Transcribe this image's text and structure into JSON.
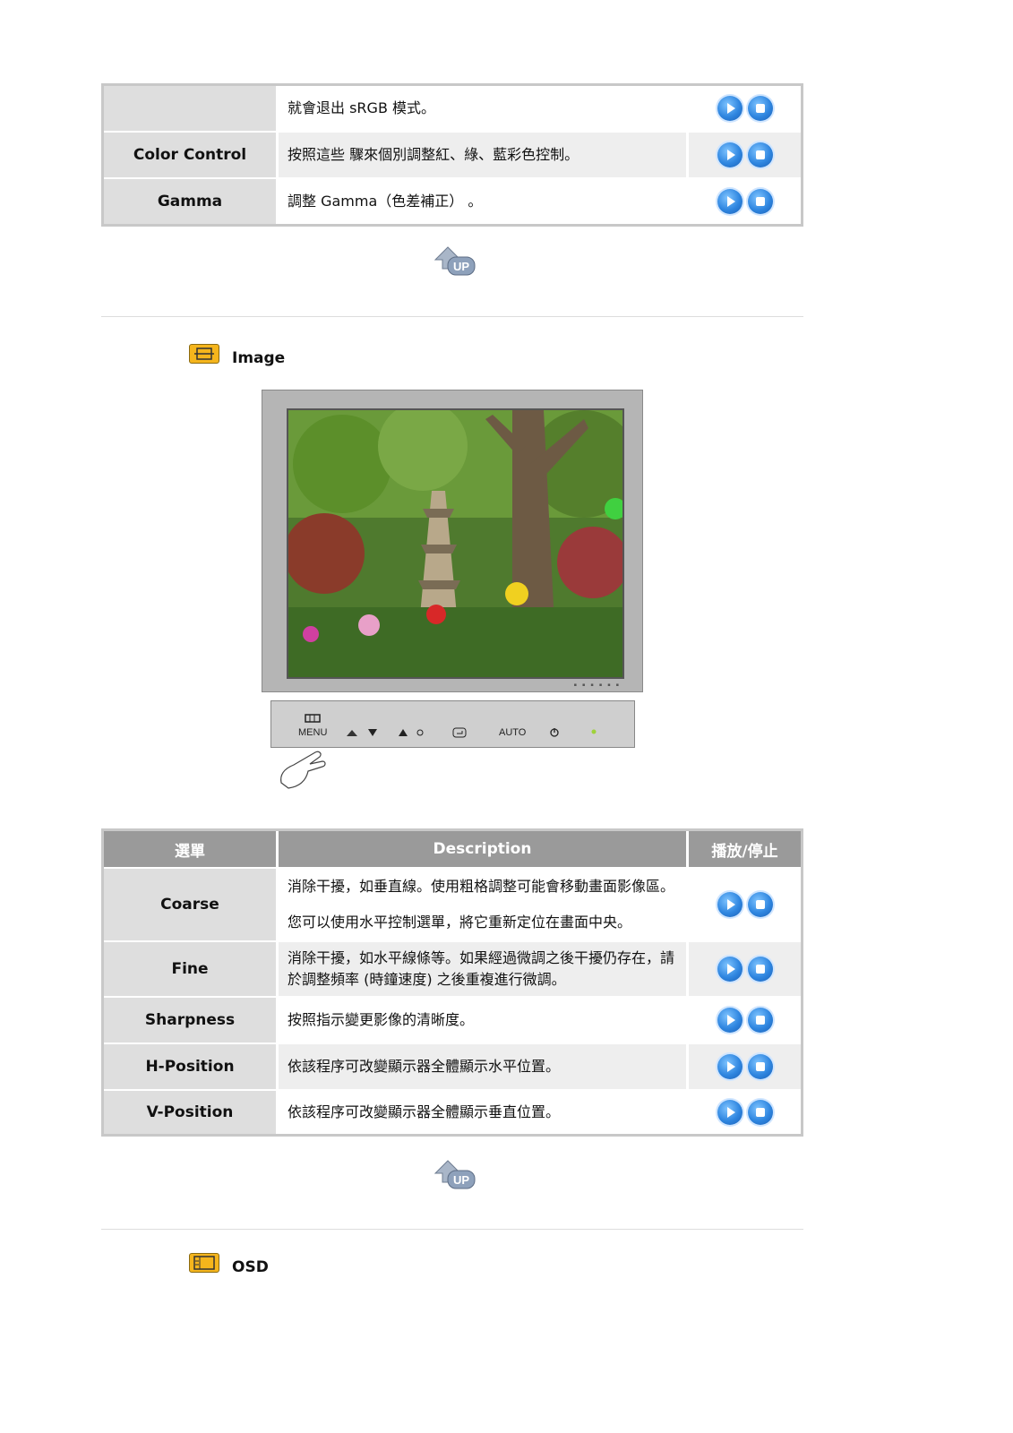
{
  "colors": {
    "header_bg": "#9a9a9a",
    "menu_bg": "#dedede",
    "alt_row_bg": "#eeeeee",
    "button_blue": "#2f86e0",
    "section_icon": "#f5b51c"
  },
  "top_table": {
    "rows": [
      {
        "menu": "",
        "desc": "就會退出 sRGB 模式。"
      },
      {
        "menu": "Color Control",
        "desc": "按照這些 驟來個別調整紅、綠、藍彩色控制。"
      },
      {
        "menu": "Gamma",
        "desc": "調整 Gamma（色差補正） 。"
      }
    ]
  },
  "sections": {
    "image_title": "Image",
    "osd_title": "OSD"
  },
  "panel": {
    "menu": "MENU",
    "auto": "AUTO"
  },
  "image_table": {
    "headers": {
      "menu": "選單",
      "desc": "Description",
      "play": "播放/停止"
    },
    "rows": [
      {
        "menu": "Coarse",
        "desc1": "消除干擾，如垂直線。使用粗格調整可能會移動畫面影像區。",
        "desc2": "您可以使用水平控制選單，將它重新定位在畫面中央。"
      },
      {
        "menu": "Fine",
        "desc1": "消除干擾，如水平線條等。如果經過微調之後干擾仍存在，請",
        "desc2": "於調整頻率 (時鐘速度) 之後重複進行微調。"
      },
      {
        "menu": "Sharpness",
        "desc1": "按照指示變更影像的清晰度。"
      },
      {
        "menu": "H-Position",
        "desc1": "依該程序可改變顯示器全體顯示水平位置。"
      },
      {
        "menu": "V-Position",
        "desc1": "依該程序可改變顯示器全體顯示垂直位置。"
      }
    ]
  }
}
